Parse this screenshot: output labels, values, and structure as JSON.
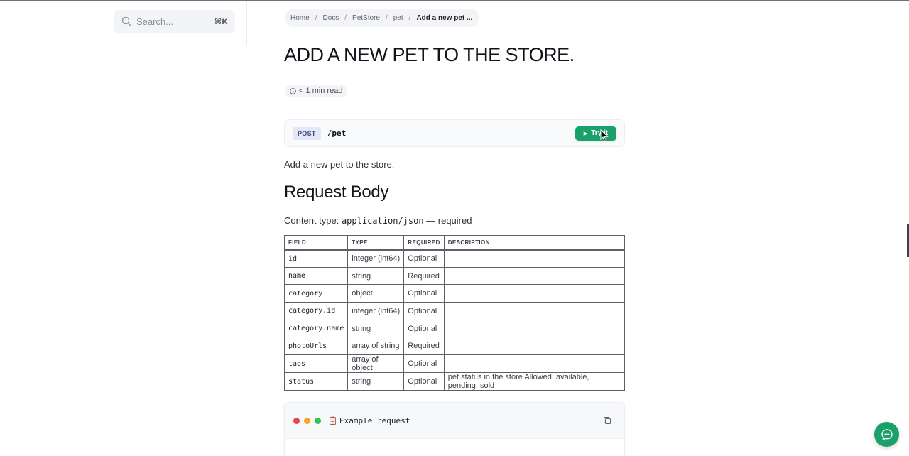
{
  "search": {
    "placeholder": "Search...",
    "shortcut": "⌘K",
    "icon": "search-icon"
  },
  "breadcrumb": {
    "items": [
      "Home",
      "Docs",
      "PetStore",
      "pet"
    ],
    "current": "Add a new pet ...",
    "separator": "/"
  },
  "page": {
    "title": "ADD A NEW PET TO THE STORE.",
    "read_time": "< 1 min read"
  },
  "endpoint": {
    "method": "POST",
    "path": "/pet",
    "try_label": "Try it"
  },
  "description": "Add a new pet to the store.",
  "request_body": {
    "title": "Request Body",
    "content_type_prefix": "Content type: ",
    "content_type": "application/json",
    "content_type_suffix": " — required"
  },
  "table": {
    "headers": [
      "FIELD",
      "TYPE",
      "REQUIRED",
      "DESCRIPTION"
    ],
    "rows": [
      [
        "id",
        "integer (int64)",
        "Optional",
        ""
      ],
      [
        "name",
        "string",
        "Required",
        ""
      ],
      [
        "category",
        "object",
        "Optional",
        ""
      ],
      [
        "category.id",
        "integer (int64)",
        "Optional",
        ""
      ],
      [
        "category.name",
        "string",
        "Optional",
        ""
      ],
      [
        "photoUrls",
        "array of string",
        "Required",
        ""
      ],
      [
        "tags",
        "array of object",
        "Optional",
        ""
      ],
      [
        "status",
        "string",
        "Optional",
        "pet status in the store Allowed: available, pending, sold"
      ]
    ]
  },
  "example": {
    "title": "Example request",
    "dot_colors": [
      "#e5484d",
      "#f5a623",
      "#30c255"
    ]
  },
  "colors": {
    "accent": "#1aa068",
    "method_bg": "#e3e8f4",
    "method_text": "#3b4f86"
  }
}
